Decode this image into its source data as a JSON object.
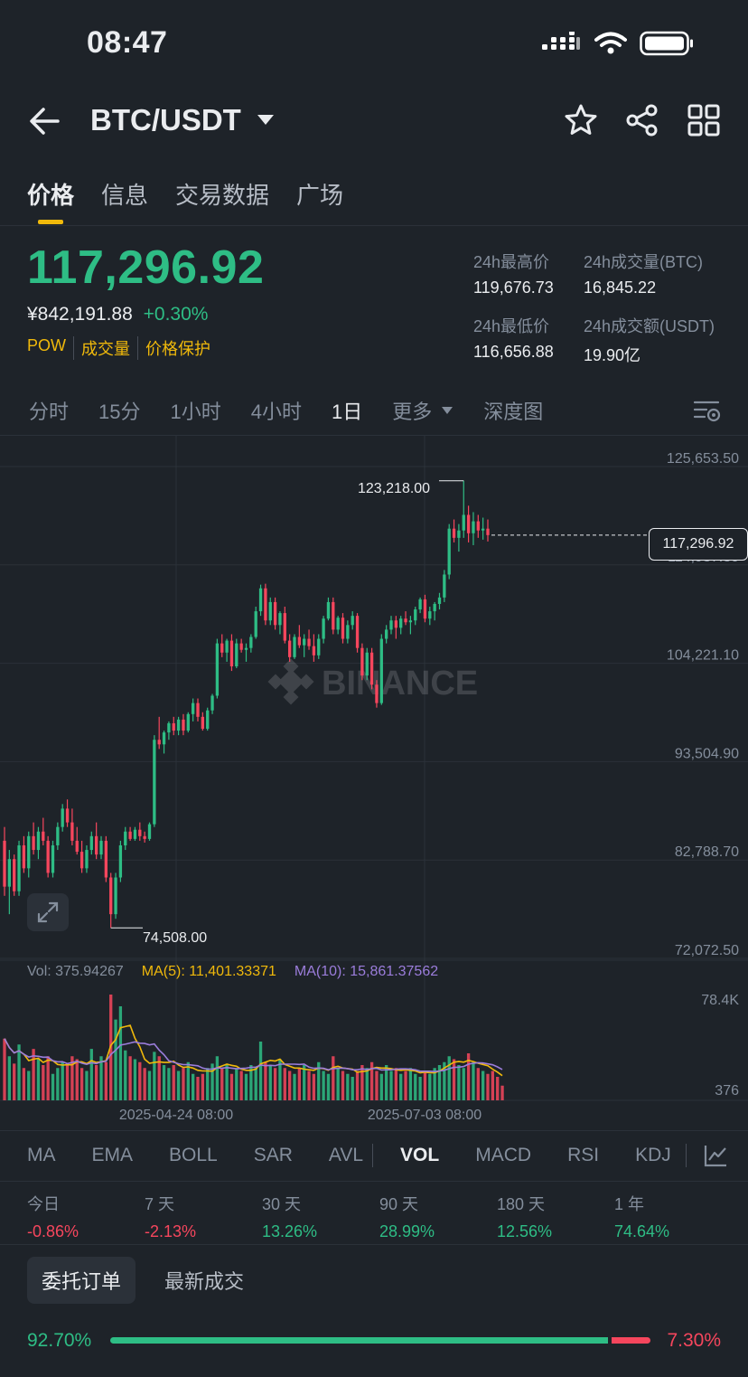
{
  "status_bar": {
    "time": "08:47"
  },
  "header": {
    "pair": "BTC/USDT"
  },
  "tabs": [
    {
      "label": "价格",
      "active": true
    },
    {
      "label": "信息",
      "active": false
    },
    {
      "label": "交易数据",
      "active": false
    },
    {
      "label": "广场",
      "active": false
    }
  ],
  "price": {
    "last": "117,296.92",
    "cny": "¥842,191.88",
    "change": "+0.30%",
    "tags": [
      "POW",
      "成交量",
      "价格保护"
    ]
  },
  "stats": {
    "high_label": "24h最高价",
    "high_value": "119,676.73",
    "vol_btc_label": "24h成交量(BTC)",
    "vol_btc_value": "16,845.22",
    "low_label": "24h最低价",
    "low_value": "116,656.88",
    "vol_usdt_label": "24h成交额(USDT)",
    "vol_usdt_value": "19.90亿"
  },
  "intervals": [
    "分时",
    "15分",
    "1小时",
    "4小时",
    "1日"
  ],
  "interval_more": "更多",
  "interval_depth": "深度图",
  "chart_data": {
    "type": "candlestick",
    "price_axis": [
      "125,653.50",
      "114,937.30",
      "104,221.10",
      "93,504.90",
      "82,788.70",
      "72,072.50"
    ],
    "current_price": "117,296.92",
    "high_marker": "123,218.00",
    "low_marker": "74,508.00",
    "watermark": "BINANCE",
    "volume_axis": [
      "78.4K",
      "376"
    ],
    "date_labels": [
      "2025-04-24 08:00",
      "2025-07-03 08:00"
    ],
    "volume_info": {
      "vol": "Vol: 375.94267",
      "ma5": "MA(5): 11,401.33371",
      "ma10": "MA(10): 15,861.37562"
    },
    "colors": {
      "up": "#2EBD85",
      "down": "#F6465D",
      "ma5": "#F0B90B",
      "ma10": "#9B7DDB"
    },
    "candles": [
      [
        84000,
        85500,
        78000,
        79000
      ],
      [
        79000,
        83000,
        76000,
        82000
      ],
      [
        82000,
        82500,
        78000,
        78500
      ],
      [
        78500,
        84000,
        78000,
        83500
      ],
      [
        83500,
        84500,
        80500,
        81000
      ],
      [
        81000,
        85000,
        80000,
        84500
      ],
      [
        84500,
        86000,
        82500,
        83000
      ],
      [
        83000,
        85500,
        82000,
        85000
      ],
      [
        85000,
        86500,
        83500,
        84000
      ],
      [
        84000,
        84500,
        80000,
        80500
      ],
      [
        80500,
        84000,
        80000,
        83500
      ],
      [
        83500,
        86000,
        83000,
        85500
      ],
      [
        85500,
        88000,
        85000,
        87500
      ],
      [
        87500,
        88500,
        85500,
        86000
      ],
      [
        86000,
        87500,
        83500,
        84000
      ],
      [
        84000,
        85500,
        82500,
        82800
      ],
      [
        82800,
        84000,
        80500,
        81000
      ],
      [
        81000,
        83500,
        80500,
        83000
      ],
      [
        83000,
        85000,
        82500,
        84500
      ],
      [
        84500,
        86000,
        82000,
        82500
      ],
      [
        82500,
        84500,
        82000,
        84000
      ],
      [
        84000,
        84500,
        79500,
        80000
      ],
      [
        80000,
        80500,
        74508,
        76000
      ],
      [
        76000,
        80500,
        75500,
        80000
      ],
      [
        80000,
        84000,
        79500,
        83500
      ],
      [
        83500,
        85500,
        83000,
        85000
      ],
      [
        85000,
        85500,
        84000,
        84200
      ],
      [
        84200,
        85500,
        84000,
        85200
      ],
      [
        85200,
        86000,
        84000,
        84500
      ],
      [
        84500,
        85000,
        83800,
        84200
      ],
      [
        84200,
        86000,
        84000,
        85800
      ],
      [
        85800,
        95500,
        85500,
        95000
      ],
      [
        95000,
        97500,
        94000,
        94500
      ],
      [
        94500,
        96000,
        93500,
        95800
      ],
      [
        95800,
        97000,
        95000,
        96800
      ],
      [
        96800,
        97500,
        95500,
        96000
      ],
      [
        96000,
        97500,
        95500,
        97200
      ],
      [
        97200,
        97800,
        95500,
        96000
      ],
      [
        96000,
        98000,
        95800,
        97800
      ],
      [
        97800,
        99500,
        97000,
        99000
      ],
      [
        99000,
        99500,
        97000,
        97500
      ],
      [
        97500,
        98000,
        96000,
        96200
      ],
      [
        96200,
        98500,
        96000,
        98200
      ],
      [
        98200,
        100000,
        97800,
        99800
      ],
      [
        99800,
        106000,
        99500,
        105500
      ],
      [
        105500,
        106500,
        104000,
        104500
      ],
      [
        104500,
        106000,
        103500,
        105800
      ],
      [
        105800,
        106500,
        102500,
        103000
      ],
      [
        103000,
        106000,
        102800,
        105500
      ],
      [
        105500,
        106000,
        104500,
        104800
      ],
      [
        104800,
        105500,
        103500,
        105000
      ],
      [
        105000,
        106500,
        104500,
        106200
      ],
      [
        106200,
        109500,
        106000,
        109000
      ],
      [
        109000,
        111900,
        108500,
        111500
      ],
      [
        111500,
        112000,
        107500,
        108000
      ],
      [
        108000,
        110500,
        107500,
        110000
      ],
      [
        110000,
        110500,
        107000,
        107500
      ],
      [
        107500,
        109000,
        106500,
        108800
      ],
      [
        108800,
        109500,
        105500,
        105800
      ],
      [
        105800,
        106500,
        103500,
        104000
      ],
      [
        104000,
        106500,
        103800,
        106200
      ],
      [
        106200,
        107500,
        105000,
        105300
      ],
      [
        105300,
        106500,
        104000,
        106000
      ],
      [
        106000,
        107000,
        104800,
        105200
      ],
      [
        105200,
        106500,
        103500,
        104200
      ],
      [
        104200,
        106500,
        103800,
        106000
      ],
      [
        106000,
        108500,
        105500,
        108200
      ],
      [
        108200,
        110500,
        108000,
        110000
      ],
      [
        110000,
        110500,
        106500,
        107000
      ],
      [
        107000,
        108500,
        106500,
        108300
      ],
      [
        108300,
        108800,
        105500,
        106000
      ],
      [
        106000,
        108000,
        105500,
        107500
      ],
      [
        107500,
        109000,
        107000,
        108500
      ],
      [
        108500,
        108800,
        104500,
        105000
      ],
      [
        105000,
        105500,
        101500,
        102000
      ],
      [
        102000,
        105000,
        101500,
        104500
      ],
      [
        104500,
        105000,
        100500,
        101000
      ],
      [
        101000,
        101500,
        98500,
        99000
      ],
      [
        99000,
        106500,
        98800,
        106000
      ],
      [
        106000,
        107500,
        105500,
        107000
      ],
      [
        107000,
        108500,
        106500,
        108000
      ],
      [
        108000,
        108500,
        106000,
        107200
      ],
      [
        107200,
        108500,
        106500,
        108200
      ],
      [
        108200,
        109000,
        107500,
        107800
      ],
      [
        107800,
        108500,
        106500,
        108000
      ],
      [
        108000,
        109500,
        107500,
        109200
      ],
      [
        109200,
        110500,
        108800,
        110300
      ],
      [
        110300,
        110800,
        107800,
        108200
      ],
      [
        108200,
        109500,
        107500,
        109000
      ],
      [
        109000,
        110000,
        108000,
        109800
      ],
      [
        109800,
        111000,
        109200,
        110500
      ],
      [
        110500,
        113500,
        110000,
        113000
      ],
      [
        113000,
        118500,
        112500,
        118000
      ],
      [
        118000,
        119000,
        116500,
        117000
      ],
      [
        117000,
        118500,
        115500,
        117800
      ],
      [
        117800,
        123218,
        117000,
        119500
      ],
      [
        119500,
        120500,
        116500,
        117500
      ],
      [
        117500,
        119800,
        116200,
        118800
      ],
      [
        118800,
        119500,
        117000,
        117800
      ],
      [
        117800,
        119200,
        116800,
        118000
      ],
      [
        118000,
        119000,
        116600,
        117296.92
      ]
    ],
    "volumes": [
      42,
      30,
      25,
      38,
      22,
      20,
      35,
      28,
      24,
      30,
      18,
      22,
      26,
      25,
      30,
      28,
      22,
      20,
      35,
      24,
      30,
      26,
      72,
      55,
      64,
      34,
      30,
      28,
      26,
      22,
      20,
      33,
      30,
      24,
      22,
      24,
      20,
      22,
      26,
      18,
      16,
      18,
      22,
      25,
      30,
      22,
      24,
      18,
      22,
      20,
      18,
      24,
      22,
      40,
      26,
      24,
      22,
      28,
      22,
      20,
      18,
      22,
      24,
      20,
      18,
      26,
      20,
      18,
      30,
      22,
      20,
      18,
      16,
      20,
      24,
      22,
      26,
      20,
      18,
      24,
      20,
      22,
      18,
      20,
      22,
      18,
      16,
      20,
      18,
      22,
      24,
      26,
      30,
      28,
      24,
      22,
      32,
      26,
      22,
      20,
      18,
      20,
      16,
      10
    ]
  },
  "indicators": [
    "MA",
    "EMA",
    "BOLL",
    "SAR",
    "AVL",
    "VOL",
    "MACD",
    "RSI",
    "KDJ"
  ],
  "active_indicator": "VOL",
  "performance": [
    {
      "label": "今日",
      "value": "-0.86%",
      "dir": "down"
    },
    {
      "label": "7 天",
      "value": "-2.13%",
      "dir": "down"
    },
    {
      "label": "30 天",
      "value": "13.26%",
      "dir": "up"
    },
    {
      "label": "90 天",
      "value": "28.99%",
      "dir": "up"
    },
    {
      "label": "180 天",
      "value": "12.56%",
      "dir": "up"
    },
    {
      "label": "1 年",
      "value": "74.64%",
      "dir": "up"
    }
  ],
  "orders": {
    "tabs": [
      {
        "label": "委托订单",
        "active": true
      },
      {
        "label": "最新成交",
        "active": false
      }
    ],
    "buy_pct": "92.70%",
    "sell_pct": "7.30%",
    "buy_ratio": 0.927
  }
}
